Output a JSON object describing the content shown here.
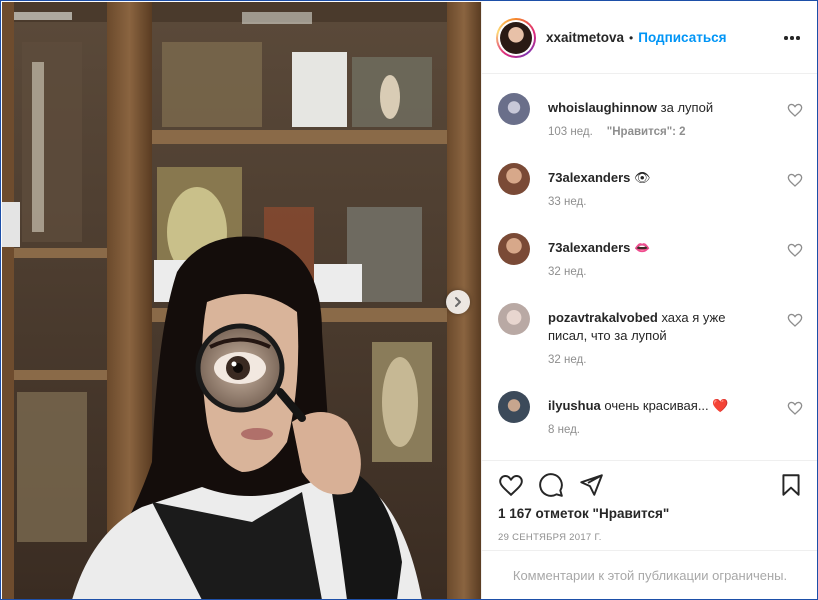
{
  "post": {
    "username": "xxaitmetova",
    "separator": "•",
    "follow_label": "Подписаться",
    "more_icon": "more-horizontal-icon"
  },
  "comments": [
    {
      "user": "whoislaughinnow",
      "text": "за лупой",
      "time": "103 нед.",
      "likes": "\"Нравится\": 2",
      "avatar_color": "#6a6f8a"
    },
    {
      "user": "73alexanders",
      "text": "👁",
      "time": "33 нед.",
      "likes": "",
      "avatar_color": "#7a4a36"
    },
    {
      "user": "73alexanders",
      "text": "👄",
      "time": "32 нед.",
      "likes": "",
      "avatar_color": "#7a4a36"
    },
    {
      "user": "pozavtrakalvobed",
      "text": "хаха я уже писал, что за лупой",
      "time": "32 нед.",
      "likes": "",
      "avatar_color": "#b9a9a4"
    },
    {
      "user": "ilyushua",
      "text": "очень красивая... ❤️",
      "time": "8 нед.",
      "likes": "",
      "avatar_color": "#3c4a5a"
    }
  ],
  "actions": {
    "like_icon": "heart-icon",
    "comment_icon": "comment-icon",
    "share_icon": "paper-plane-icon",
    "save_icon": "bookmark-icon"
  },
  "likes_count": "1 167 отметок \"Нравится\"",
  "date": "29 СЕНТЯБРЯ 2017 Г.",
  "comments_disabled": "Комментарии к этой публикации ограничены.",
  "colors": {
    "accent": "#0095f6",
    "text": "#262626",
    "muted": "#8e8e8e",
    "border": "#efefef"
  }
}
